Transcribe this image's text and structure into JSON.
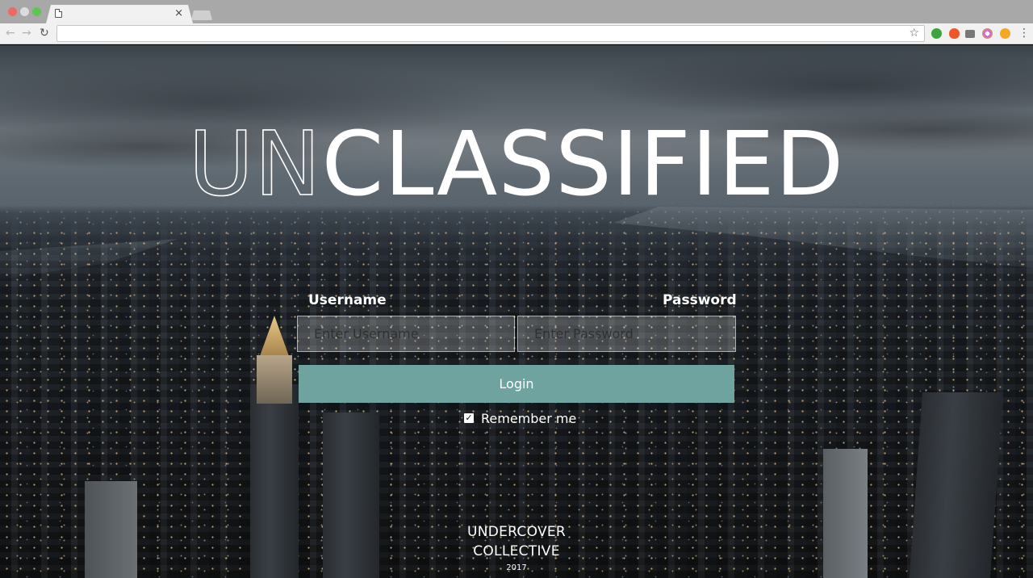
{
  "browser": {
    "tab_close": "×",
    "nav": {
      "back": "←",
      "forward": "→",
      "reload": "↻"
    },
    "address": "",
    "star": "☆",
    "menu": "⋮",
    "extensions": [
      "green-extension-icon",
      "fire-extension-icon",
      "camera-extension-icon",
      "instagram-extension-icon",
      "play-extension-icon"
    ]
  },
  "page": {
    "brand": {
      "thin": "UN",
      "bold": "CLASSIFIED"
    },
    "username": {
      "label": "Username",
      "placeholder": "Enter Username",
      "value": ""
    },
    "password": {
      "label": "Password",
      "placeholder": "Enter Password",
      "value": ""
    },
    "login_button": "Login",
    "remember": {
      "label": "Remember me",
      "checked": true,
      "mark": "✓"
    },
    "footer": {
      "line1": "UNDERCOVER",
      "line2": "COLLECTIVE",
      "year": "2017"
    },
    "colors": {
      "button": "#6ea3a0",
      "text": "#ffffff"
    }
  }
}
